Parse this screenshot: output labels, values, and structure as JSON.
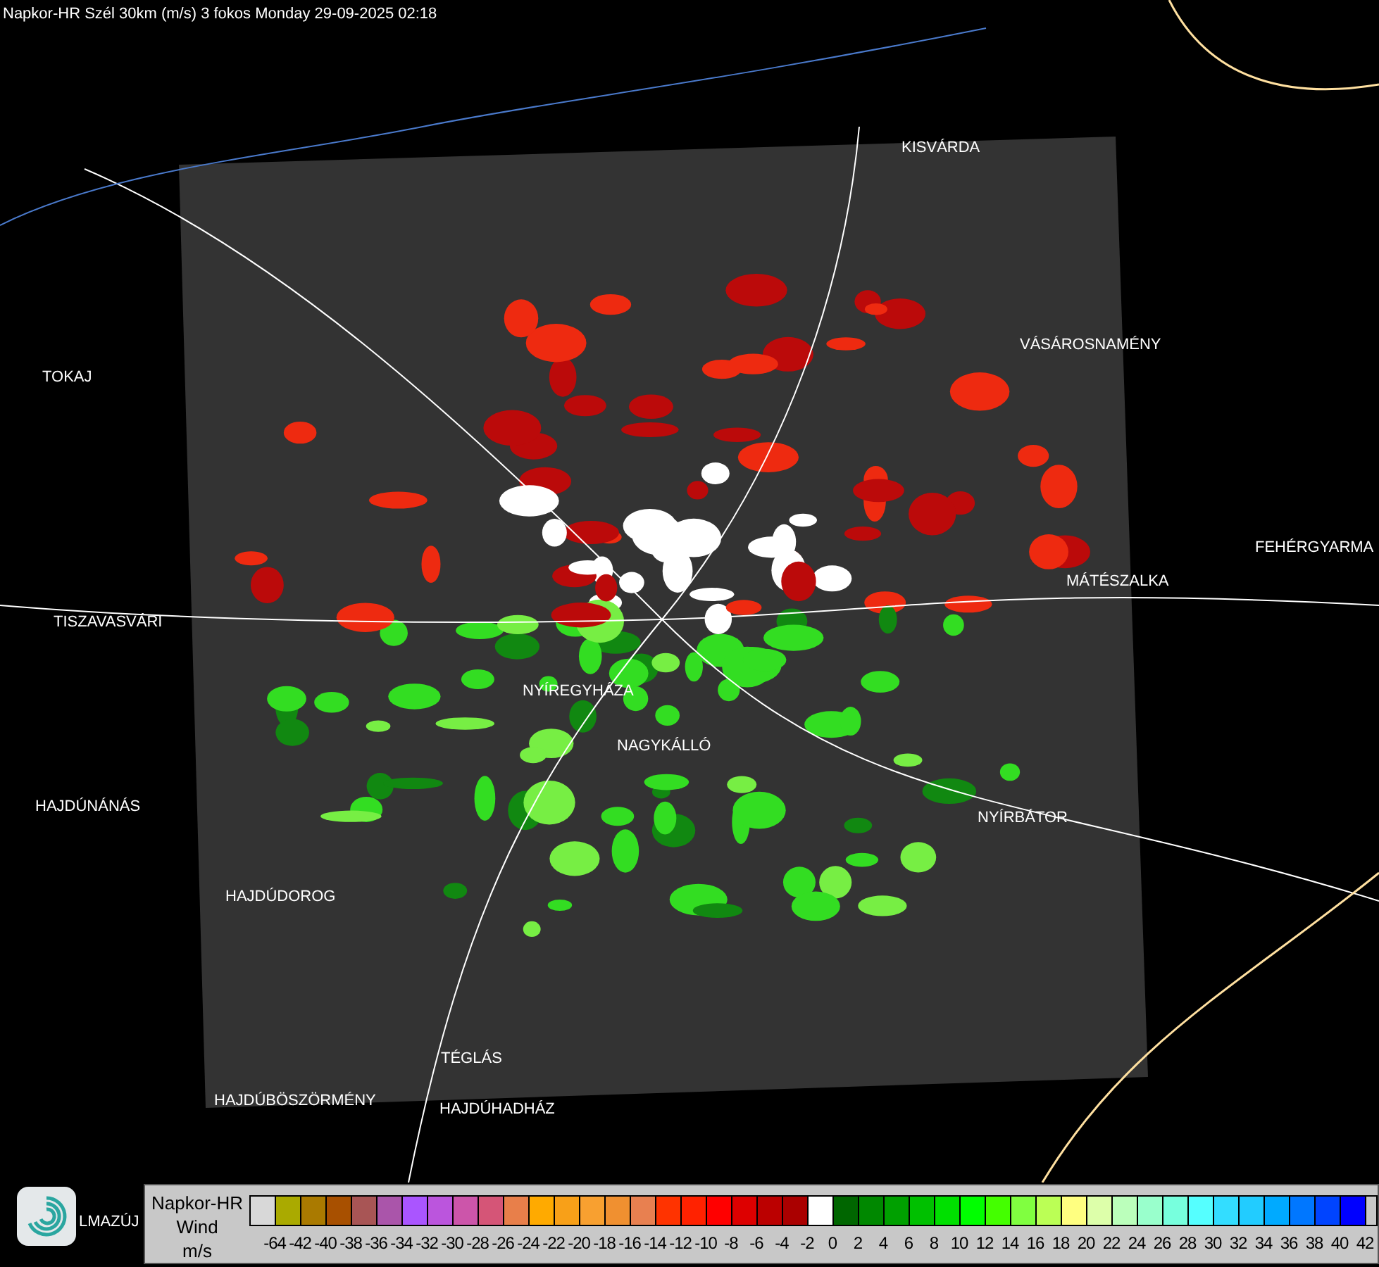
{
  "title": "Napkor-HR Szél 30km (m/s) 3 fokos Monday 29-09-2025 02:18",
  "map": {
    "places": [
      {
        "name": "KISVÁRDA"
      },
      {
        "name": "VÁSÁROSNAMÉNY"
      },
      {
        "name": "TOKAJ"
      },
      {
        "name": "FEHÉRGYARMA"
      },
      {
        "name": "MÁTÉSZALKA"
      },
      {
        "name": "TISZAVASVÁRI"
      },
      {
        "name": "NYÍREGYHÁZA"
      },
      {
        "name": "NAGYKÁLLÓ"
      },
      {
        "name": "HAJDÚNÁNÁS"
      },
      {
        "name": "NYÍRBÁTOR"
      },
      {
        "name": "HAJDÚDOROG"
      },
      {
        "name": "TÉGLÁS"
      },
      {
        "name": "HAJDÚBÖSZÖRMÉNY"
      },
      {
        "name": "HAJDÚHADHÁZ"
      },
      {
        "name": "LMAZÚJ"
      }
    ]
  },
  "legend": {
    "lines": [
      "Napkor-HR",
      "Wind",
      "m/s"
    ],
    "swatches": [
      {
        "color": "#d8d8d8"
      },
      {
        "color": "#aaaa00"
      },
      {
        "color": "#aa7a00"
      },
      {
        "color": "#a85000"
      },
      {
        "color": "#a85555"
      },
      {
        "color": "#aa55aa"
      },
      {
        "color": "#aa55ff"
      },
      {
        "color": "#bb55dd"
      },
      {
        "color": "#cc55aa"
      },
      {
        "color": "#d55577"
      },
      {
        "color": "#e87f4a"
      },
      {
        "color": "#ffaa00"
      },
      {
        "color": "#f8a018"
      },
      {
        "color": "#f8a030"
      },
      {
        "color": "#f09030"
      },
      {
        "color": "#e88050"
      },
      {
        "color": "#ff3300"
      },
      {
        "color": "#ff2200"
      },
      {
        "color": "#ff0000"
      },
      {
        "color": "#dd0000"
      },
      {
        "color": "#bb0000"
      },
      {
        "color": "#aa0000"
      },
      {
        "color": "#ffffff"
      },
      {
        "color": "#006600"
      },
      {
        "color": "#008800"
      },
      {
        "color": "#00a000"
      },
      {
        "color": "#00c000"
      },
      {
        "color": "#00e000"
      },
      {
        "color": "#00ff00"
      },
      {
        "color": "#44ff00"
      },
      {
        "color": "#80ff40"
      },
      {
        "color": "#bbff55"
      },
      {
        "color": "#ffff80"
      },
      {
        "color": "#ddffaa"
      },
      {
        "color": "#bbffbb"
      },
      {
        "color": "#99ffcc"
      },
      {
        "color": "#77ffdd"
      },
      {
        "color": "#55ffff"
      },
      {
        "color": "#33ddff"
      },
      {
        "color": "#22ccff"
      },
      {
        "color": "#00aaff"
      },
      {
        "color": "#0077ff"
      },
      {
        "color": "#0044ff"
      },
      {
        "color": "#0000ff"
      }
    ],
    "labels": [
      "-64",
      "-42",
      "-40",
      "-38",
      "-36",
      "-34",
      "-32",
      "-30",
      "-28",
      "-26",
      "-24",
      "-22",
      "-20",
      "-18",
      "-16",
      "-14",
      "-12",
      "-10",
      "-8",
      "-6",
      "-4",
      "-2",
      "0",
      "2",
      "4",
      "6",
      "8",
      "10",
      "12",
      "14",
      "16",
      "18",
      "20",
      "22",
      "24",
      "26",
      "28",
      "30",
      "32",
      "34",
      "36",
      "38",
      "40",
      "42"
    ]
  }
}
